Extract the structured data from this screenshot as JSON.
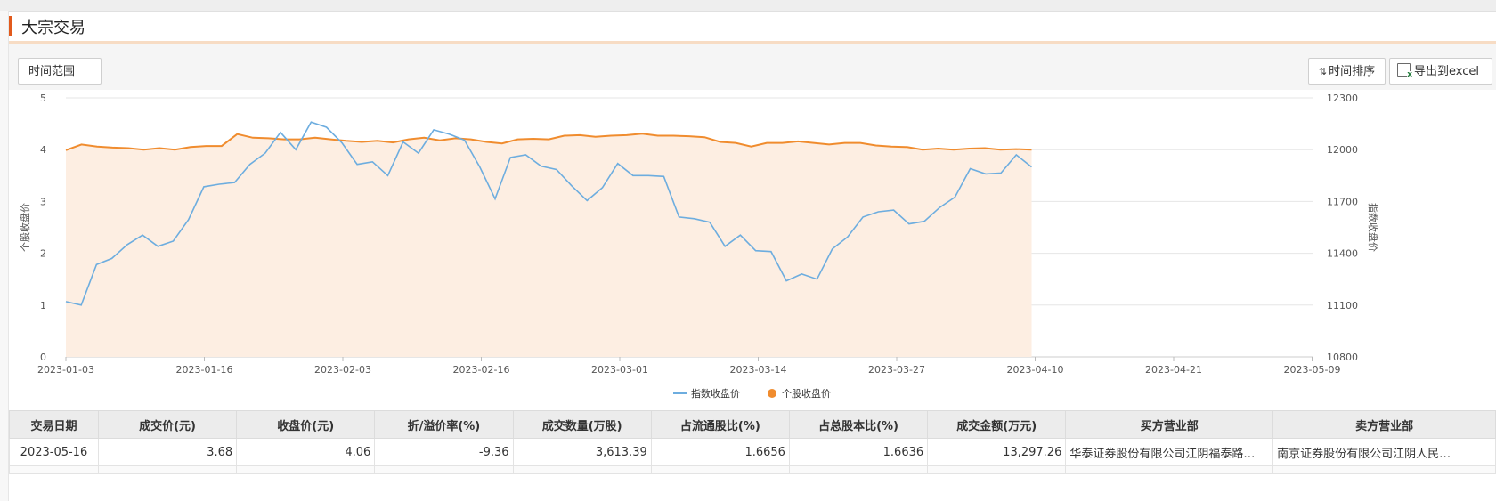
{
  "header": {
    "title": "大宗交易"
  },
  "toolbar": {
    "range_label": "时间范围",
    "sort_label": "时间排序",
    "excel_label": "导出到excel"
  },
  "colors": {
    "accent": "#e25a1c",
    "index_line": "#6daddf",
    "stock_line": "#f08c2e",
    "stock_area": "#fdeee2"
  },
  "chart_data": {
    "type": "line",
    "x_ticks": [
      "2023-01-03",
      "2023-01-16",
      "2023-02-03",
      "2023-02-16",
      "2023-03-01",
      "2023-03-14",
      "2023-03-27",
      "2023-04-10",
      "2023-04-21",
      "2023-05-09"
    ],
    "left_axis": {
      "label": "个股收盘价",
      "ticks": [
        "0",
        "1",
        "2",
        "3",
        "4",
        "5"
      ],
      "ylim": [
        0,
        5
      ]
    },
    "right_axis": {
      "label": "指数收盘价",
      "ticks": [
        "10800",
        "11100",
        "11400",
        "11700",
        "12000",
        "12300"
      ],
      "ylim": [
        10800,
        12300
      ]
    },
    "grid": true,
    "legend_position": "bottom-center",
    "series": [
      {
        "name": "指数收盘价",
        "axis": "right",
        "values": [
          11120,
          11100,
          11335,
          11370,
          11450,
          11505,
          11440,
          11470,
          11595,
          11785,
          11800,
          11810,
          11915,
          11980,
          12100,
          12000,
          12160,
          12130,
          12040,
          11915,
          11930,
          11850,
          12045,
          11980,
          12115,
          12090,
          12055,
          11900,
          11715,
          11955,
          11970,
          11905,
          11885,
          11790,
          11705,
          11780,
          11920,
          11850,
          11850,
          11845,
          11610,
          11600,
          11580,
          11440,
          11505,
          11415,
          11410,
          11240,
          11280,
          11250,
          11425,
          11495,
          11610,
          11640,
          11650,
          11570,
          11585,
          11665,
          11725,
          11890,
          11860,
          11865,
          11970,
          11900
        ]
      },
      {
        "name": "个股收盘价",
        "axis": "left",
        "values": [
          3.99,
          4.1,
          4.06,
          4.04,
          4.03,
          4.0,
          4.03,
          4.0,
          4.05,
          4.07,
          4.07,
          4.3,
          4.23,
          4.22,
          4.2,
          4.2,
          4.23,
          4.2,
          4.17,
          4.15,
          4.17,
          4.14,
          4.2,
          4.23,
          4.18,
          4.22,
          4.2,
          4.15,
          4.12,
          4.2,
          4.21,
          4.2,
          4.27,
          4.28,
          4.25,
          4.27,
          4.28,
          4.31,
          4.27,
          4.27,
          4.26,
          4.24,
          4.15,
          4.13,
          4.06,
          4.13,
          4.13,
          4.16,
          4.13,
          4.1,
          4.13,
          4.13,
          4.08,
          4.06,
          4.05,
          4.0,
          4.02,
          4.0,
          4.02,
          4.03,
          4.0,
          4.01,
          4.0
        ]
      }
    ]
  },
  "table": {
    "headers": [
      "交易日期",
      "成交价(元)",
      "收盘价(元)",
      "折/溢价率(%)",
      "成交数量(万股)",
      "占流通股比(%)",
      "占总股本比(%)",
      "成交金额(万元)",
      "买方营业部",
      "卖方营业部"
    ],
    "rows": [
      [
        "2023-05-16",
        "3.68",
        "4.06",
        "-9.36",
        "3,613.39",
        "1.6656",
        "1.6636",
        "13,297.26",
        "华泰证券股份有限公司江阴福泰路…",
        "南京证券股份有限公司江阴人民…"
      ]
    ]
  }
}
